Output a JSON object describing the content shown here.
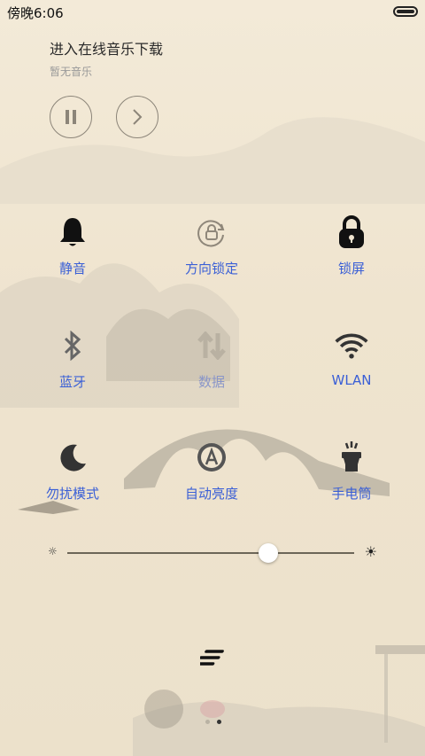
{
  "status": {
    "time": "傍晚6:06"
  },
  "music": {
    "title": "进入在线音乐下载",
    "subtitle": "暂无音乐"
  },
  "controls": {
    "pause_icon": "pause-icon",
    "next_icon": "chevron-right-icon"
  },
  "toggles": {
    "mute": {
      "label": "静音",
      "icon": "bell-icon"
    },
    "rotation_lock": {
      "label": "方向锁定",
      "icon": "rotation-lock-icon"
    },
    "lock_screen": {
      "label": "锁屏",
      "icon": "padlock-icon"
    },
    "bluetooth": {
      "label": "蓝牙",
      "icon": "bluetooth-icon"
    },
    "data": {
      "label": "数据",
      "icon": "data-arrows-icon"
    },
    "wlan": {
      "label": "WLAN",
      "icon": "wifi-icon"
    },
    "dnd": {
      "label": "勿扰模式",
      "icon": "moon-icon"
    },
    "auto_brightness": {
      "label": "自动亮度",
      "icon": "auto-brightness-icon"
    },
    "flashlight": {
      "label": "手电筒",
      "icon": "flashlight-icon"
    }
  },
  "brightness": {
    "level": 0.7
  },
  "colors": {
    "accent": "#3a5fd6",
    "background": "#efe4cf"
  }
}
